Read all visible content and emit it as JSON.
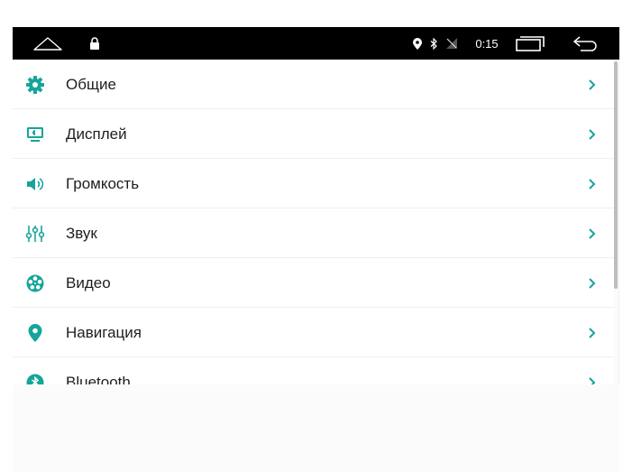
{
  "status_bar": {
    "time": "0:15",
    "icons": [
      "home-icon",
      "lock-icon",
      "location-icon",
      "bluetooth-icon",
      "no-signal-icon",
      "recent-apps-icon",
      "back-icon"
    ],
    "background": "#000000"
  },
  "settings": {
    "accent_color": "#16a59a",
    "items": [
      {
        "label": "Общие",
        "icon": "gear-icon"
      },
      {
        "label": "Дисплей",
        "icon": "display-icon"
      },
      {
        "label": "Громкость",
        "icon": "volume-icon"
      },
      {
        "label": "Звук",
        "icon": "equalizer-icon"
      },
      {
        "label": "Видео",
        "icon": "film-reel-icon"
      },
      {
        "label": "Навигация",
        "icon": "map-pin-icon"
      },
      {
        "label": "Bluetooth",
        "icon": "bluetooth-icon"
      }
    ]
  }
}
